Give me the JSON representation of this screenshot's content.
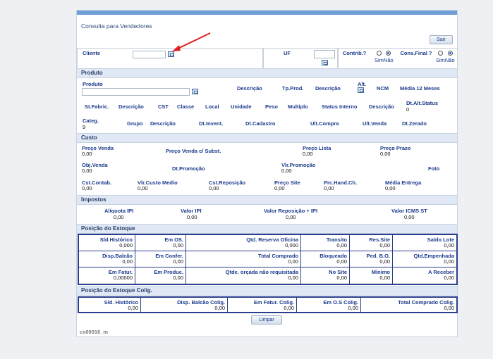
{
  "page": {
    "title": "Consulta para Vendedores",
    "sair_label": "Sair",
    "limpar_label": "Limpar",
    "footer_code": "cs00316_m"
  },
  "cliente": {
    "label": "Cliente",
    "value": ""
  },
  "uf": {
    "label": "UF",
    "value": ""
  },
  "contrib": {
    "label": "Contrib.?",
    "options": "SimNão",
    "selected": "Não"
  },
  "consfinal": {
    "label": "Cons.Final ?",
    "options": "SimNão",
    "selected": "Não"
  },
  "produto": {
    "section": "Produto",
    "label": "Produto",
    "descricao1": "Descrição",
    "tp_prod": "Tp.Prod.",
    "descricao2": "Descrição",
    "alt": "Alt.",
    "ncm": "NCM",
    "media12": "Média 12 Meses",
    "st_fabric": "St.Fabric.",
    "descricao3": "Descrição",
    "cst": "CST",
    "classe": "Classe",
    "local": "Local",
    "unidade": "Unidade",
    "peso": "Peso",
    "multiplo": "Multiplo",
    "status_interno": "Status Interno",
    "descricao4": "Descrição",
    "dt_alt_status": "Dt.Alt.Status",
    "dt_alt_status_val": "0",
    "categ": "Categ.",
    "categ_val": "9",
    "grupo": "Grupo",
    "descricao5": "Descrição",
    "dt_invent": "Dt.Invent.",
    "dt_cadastro": "Dt.Cadastro",
    "ult_compra": "Ult.Compra",
    "ult_venda": "Ult.Venda",
    "dt_zerado": "Dt.Zerado"
  },
  "custo": {
    "section": "Custo",
    "preco_venda": {
      "label": "Preço Venda",
      "value": "0,00"
    },
    "preco_venda_subst": {
      "label": "Preço Venda c/ Subst."
    },
    "preco_lista": {
      "label": "Preço Lista",
      "value": "0,00"
    },
    "preco_prazo": {
      "label": "Preço Prazo",
      "value": "0,00"
    },
    "obj_venda": {
      "label": "Obj.Venda",
      "value": "0,00"
    },
    "dt_promocao": {
      "label": "Dt.Promoção"
    },
    "vlr_promocao": {
      "label": "Vlr.Promoção",
      "value": "0,00"
    },
    "foto": {
      "label": "Foto"
    },
    "cst_contab": {
      "label": "Cst.Contab.",
      "value": "0,00"
    },
    "vlr_custo_medio": {
      "label": "Vlr.Custo Medio",
      "value": "0,00"
    },
    "cst_reposicao": {
      "label": "Cst.Reposição",
      "value": "0,00"
    },
    "preco_site": {
      "label": "Preço Site",
      "value": "0,00"
    },
    "prc_hand": {
      "label": "Prc.Hand.Ch.",
      "value": "0,00"
    },
    "media_entrega": {
      "label": "Média Entrega",
      "value": "0,00"
    }
  },
  "impostos": {
    "section": "Impostos",
    "aliquota_ipi": {
      "label": "Alíquota IPI",
      "value": "0,00"
    },
    "valor_ipi": {
      "label": "Valor IPI",
      "value": "0,00"
    },
    "valor_reposicao_ipi": {
      "label": "Valor Reposição + IPI",
      "value": "0,00"
    },
    "valor_icms_st": {
      "label": "Valor ICMS ST",
      "value": "0,00"
    }
  },
  "estoque": {
    "section": "Posição do Estoque",
    "cells": [
      {
        "label": "Sld.Histórico",
        "value": "0,000"
      },
      {
        "label": "Em OS.",
        "value": "0,00"
      },
      {
        "label": "Qtd. Reserva Oficina",
        "value": "0,000"
      },
      {
        "label": "Transito",
        "value": "0,00"
      },
      {
        "label": "Res.Site",
        "value": "0,00"
      },
      {
        "label": "Saldo Lote",
        "value": "0,00"
      },
      {
        "label": "Disp.Balcão",
        "value": "0,00"
      },
      {
        "label": "Em Confer.",
        "value": "0,00"
      },
      {
        "label": "Total Comprado",
        "value": "0,00"
      },
      {
        "label": "Bloqueado",
        "value": "0,00"
      },
      {
        "label": "Ped. B.O.",
        "value": "0,00"
      },
      {
        "label": "Qtd.Empenhada",
        "value": "0,00"
      },
      {
        "label": "Em Fatur.",
        "value": "0,00000"
      },
      {
        "label": "Em Produc.",
        "value": "0,00"
      },
      {
        "label": "Qtde. orçada não requisitada",
        "value": "0,00"
      },
      {
        "label": "No Site",
        "value": "0,00"
      },
      {
        "label": "Mínimo",
        "value": "0,00"
      },
      {
        "label": "A Receber",
        "value": "0,00"
      }
    ]
  },
  "estoque_colig": {
    "section": "Posição do Estoque Colig.",
    "cells": [
      {
        "label": "Sld. Histórico",
        "value": "0,00"
      },
      {
        "label": "Disp. Balcão Colig.",
        "value": "0,00"
      },
      {
        "label": "Em Fatur. Colig.",
        "value": "0,00"
      },
      {
        "label": "Em O.S Colig.",
        "value": "0,00"
      },
      {
        "label": "Total Comprado Colig.",
        "value": "0,00"
      }
    ]
  },
  "colors": {
    "accent": "#6f9fd6",
    "annotation_arrow": "#e02020",
    "grid_border": "#2a3e8e"
  }
}
